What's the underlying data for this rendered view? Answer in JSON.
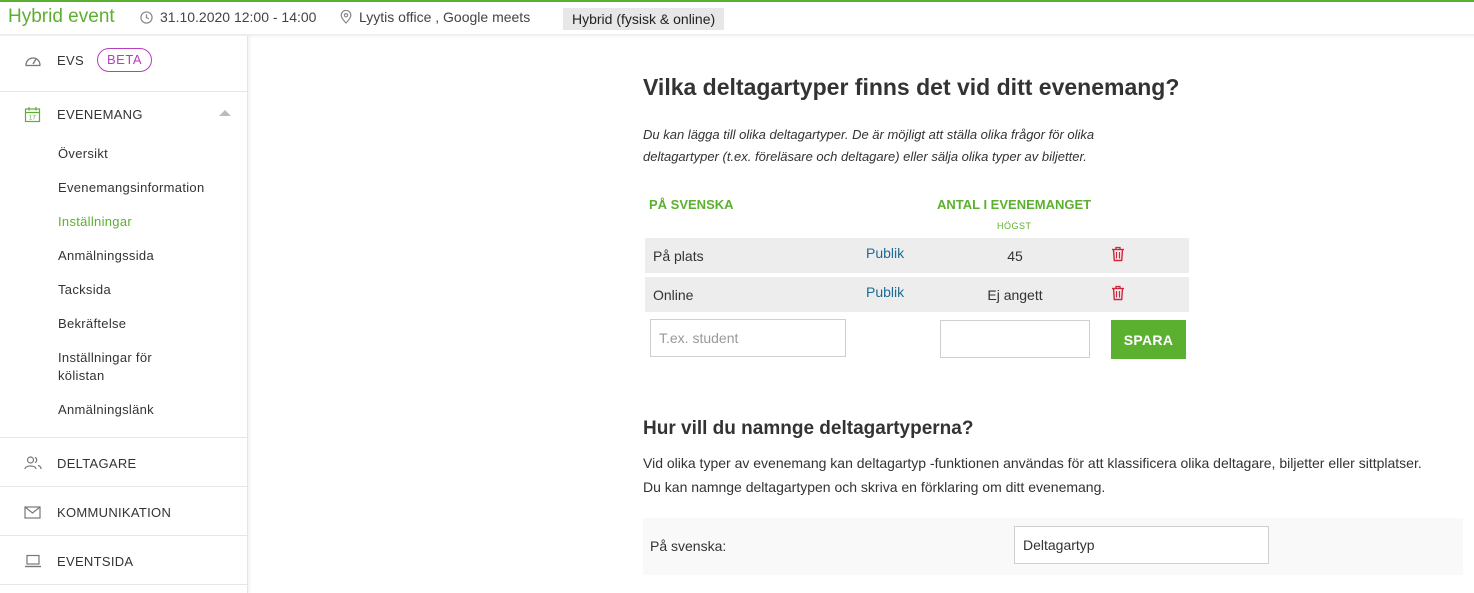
{
  "header": {
    "title": "Hybrid event",
    "datetime": "31.10.2020 12:00 - 14:00",
    "location": "Lyytis office , Google meets",
    "mode": "Hybrid (fysisk & online)",
    "accent_color": "#5cb030"
  },
  "sidebar": {
    "evs": {
      "label": "EVS",
      "badge": "BETA",
      "icon": "dashboard-icon"
    },
    "evenemang": {
      "label": "EVENEMANG",
      "icon": "calendar-icon",
      "expanded": true
    },
    "sub_items": [
      {
        "label": "Översikt",
        "active": false
      },
      {
        "label": "Evenemangsinformation",
        "active": false
      },
      {
        "label": "Inställningar",
        "active": true
      },
      {
        "label": "Anmälningssida",
        "active": false
      },
      {
        "label": "Tacksida",
        "active": false
      },
      {
        "label": "Bekräftelse",
        "active": false
      },
      {
        "label": "Inställningar för kölistan",
        "active": false
      },
      {
        "label": "Anmälningslänk",
        "active": false
      }
    ],
    "deltagare": {
      "label": "DELTAGARE",
      "icon": "users-icon"
    },
    "kommunikation": {
      "label": "KOMMUNIKATION",
      "icon": "envelope-icon"
    },
    "eventsida": {
      "label": "EVENTSIDA",
      "icon": "laptop-icon"
    }
  },
  "main": {
    "heading": "Vilka deltagartyper finns det vid ditt evenemang?",
    "intro": "Du kan lägga till olika deltagartyper. De är möjligt att ställa olika frågor för olika deltagartyper (t.ex. föreläsare och deltagare) eller sälja olika typer av biljetter.",
    "table": {
      "col_swedish": "PÅ SVENSKA",
      "col_count": "ANTAL I EVENEMANGET",
      "col_count_sub": "HÖGST",
      "rows": [
        {
          "name": "På plats",
          "visibility": "Publik",
          "max": "45"
        },
        {
          "name": "Online",
          "visibility": "Publik",
          "max": "Ej angett"
        }
      ],
      "new_type_placeholder": "T.ex. student",
      "new_count_value": "",
      "save_label": "SPARA"
    },
    "naming": {
      "heading": "Hur vill du namnge deltagartyperna?",
      "line1": "Vid olika typer av evenemang kan deltagartyp -funktionen användas för att klassificera olika deltagare, biljetter eller sittplatser.",
      "line2": "Du kan namnge deltagartypen och skriva en förklaring om ditt evenemang.",
      "label": "På svenska:",
      "value": "Deltagartyp"
    }
  }
}
